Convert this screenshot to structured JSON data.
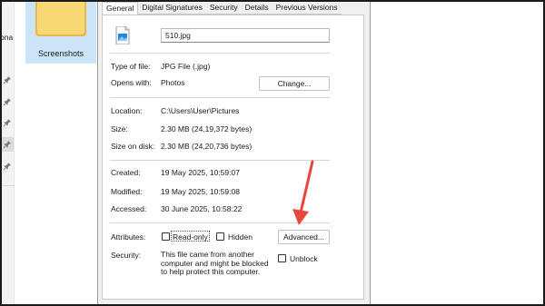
{
  "explorer": {
    "left_cut_text": "ona",
    "folder_label": "Screenshots"
  },
  "dialog": {
    "tabs": [
      {
        "label": "General",
        "active": true
      },
      {
        "label": "Digital Signatures",
        "active": false
      },
      {
        "label": "Security",
        "active": false
      },
      {
        "label": "Details",
        "active": false
      },
      {
        "label": "Previous Versions",
        "active": false
      }
    ],
    "file_name": "510.jpg",
    "type_label": "Type of file:",
    "type_value": "JPG File (.jpg)",
    "opens_label": "Opens with:",
    "opens_value": "Photos",
    "change_button": "Change...",
    "location_label": "Location:",
    "location_value": "C:\\Users\\User\\Pictures",
    "size_label": "Size:",
    "size_value": "2.30 MB (24,19,372 bytes)",
    "size_on_disk_label": "Size on disk:",
    "size_on_disk_value": "2.30 MB (24,20,736 bytes)",
    "created_label": "Created:",
    "created_value": "19 May 2025, 10:59:07",
    "modified_label": "Modified:",
    "modified_value": "19 May 2025, 10:59:08",
    "accessed_label": "Accessed:",
    "accessed_value": "30 June 2025, 10:58:22",
    "attributes_label": "Attributes:",
    "readonly_label": "Read-only",
    "hidden_label": "Hidden",
    "advanced_button": "Advanced...",
    "security_label": "Security:",
    "security_message": "This file came from another computer and might be blocked to help protect this computer.",
    "unblock_label": "Unblock"
  },
  "colors": {
    "dialog_bg": "#f0f0f0",
    "folder_selected_bg": "#cce4f7",
    "folder_yellow": "#f8d775",
    "arrow_red": "#e8473c",
    "image_icon_blue": "#1e88e5"
  },
  "icons": [
    "pin-icon",
    "folder-icon",
    "image-file-icon",
    "annotation-arrow"
  ]
}
